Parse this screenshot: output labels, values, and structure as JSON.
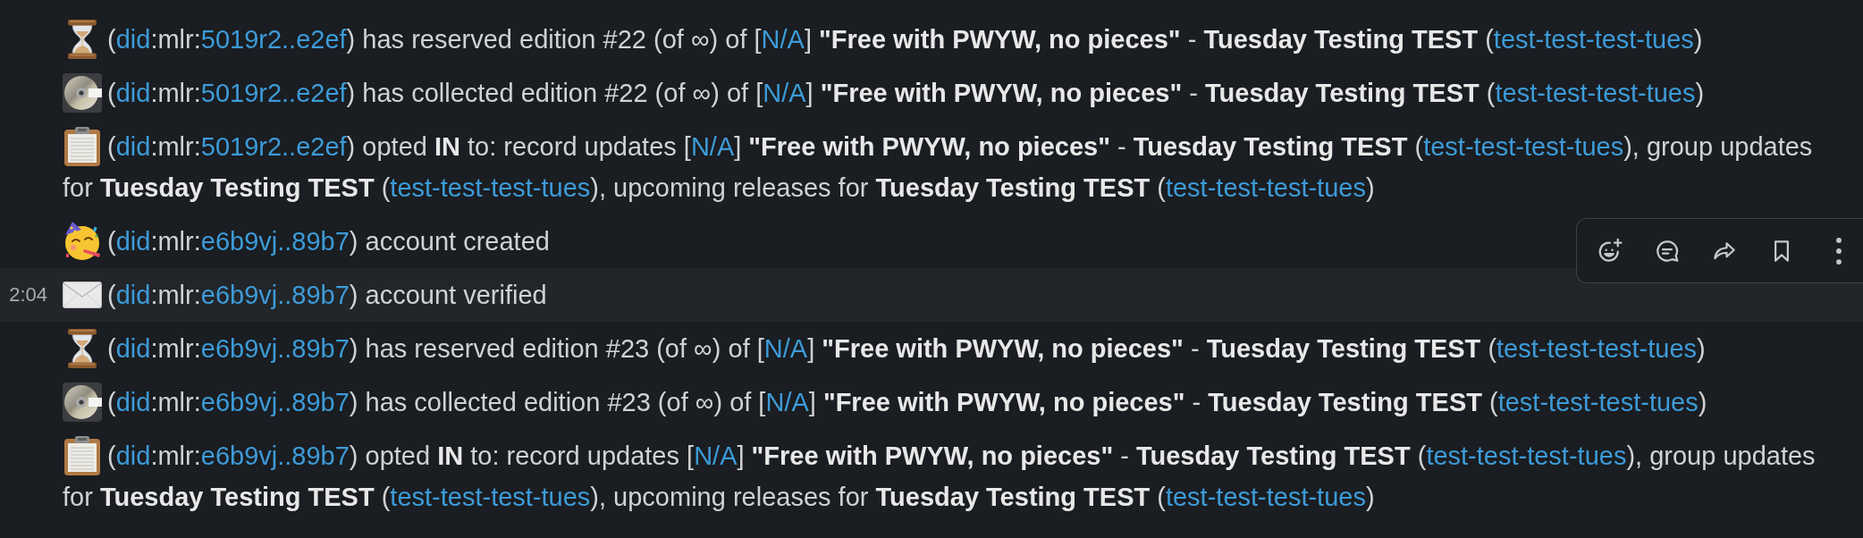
{
  "messages": [
    {
      "kind": "reserve",
      "hovered": false,
      "segments": [
        {
          "kind": "text",
          "text": "("
        },
        {
          "kind": "link",
          "text": "did"
        },
        {
          "kind": "text",
          "text": ":mlr:"
        },
        {
          "kind": "link",
          "text": "5019r2..e2ef"
        },
        {
          "kind": "text",
          "text": ") has reserved edition #22 (of ∞) of ["
        },
        {
          "kind": "link",
          "text": "N/A"
        },
        {
          "kind": "text",
          "text": "] **\"Free with PWYW, no pieces\"** - **Tuesday Testing TEST** ("
        },
        {
          "kind": "link",
          "text": "test-test-test-tues"
        },
        {
          "kind": "text",
          "text": ")"
        }
      ]
    },
    {
      "kind": "collect",
      "hovered": false,
      "segments": [
        {
          "kind": "text",
          "text": "("
        },
        {
          "kind": "link",
          "text": "did"
        },
        {
          "kind": "text",
          "text": ":mlr:"
        },
        {
          "kind": "link",
          "text": "5019r2..e2ef"
        },
        {
          "kind": "text",
          "text": ") has collected edition #22 (of ∞) of ["
        },
        {
          "kind": "link",
          "text": "N/A"
        },
        {
          "kind": "text",
          "text": "] **\"Free with PWYW, no pieces\"** - **Tuesday Testing TEST** ("
        },
        {
          "kind": "link",
          "text": "test-test-test-tues"
        },
        {
          "kind": "text",
          "text": ")"
        }
      ]
    },
    {
      "kind": "subscribe",
      "hovered": false,
      "segments": [
        {
          "kind": "text",
          "text": "("
        },
        {
          "kind": "link",
          "text": "did"
        },
        {
          "kind": "text",
          "text": ":mlr:"
        },
        {
          "kind": "link",
          "text": "5019r2..e2ef"
        },
        {
          "kind": "text",
          "text": ") opted **IN** to: record updates ["
        },
        {
          "kind": "link",
          "text": "N/A"
        },
        {
          "kind": "text",
          "text": "] **\"Free with PWYW, no pieces\"** - **Tuesday Testing TEST** ("
        },
        {
          "kind": "link",
          "text": "test-test-test-tues"
        },
        {
          "kind": "text",
          "text": "), group updates for **Tuesday Testing TEST** ("
        },
        {
          "kind": "link",
          "text": "test-test-test-tues"
        },
        {
          "kind": "text",
          "text": "), upcoming releases for **Tuesday Testing TEST** ("
        },
        {
          "kind": "link",
          "text": "test-test-test-tues"
        },
        {
          "kind": "text",
          "text": ")"
        }
      ]
    },
    {
      "kind": "signup",
      "hovered": false,
      "segments": [
        {
          "kind": "text",
          "text": "("
        },
        {
          "kind": "link",
          "text": "did"
        },
        {
          "kind": "text",
          "text": ":mlr:"
        },
        {
          "kind": "link",
          "text": "e6b9vj..89b7"
        },
        {
          "kind": "text",
          "text": ") account created"
        }
      ]
    },
    {
      "kind": "verify",
      "hovered": true,
      "time": "2:04",
      "segments": [
        {
          "kind": "text",
          "text": "("
        },
        {
          "kind": "link",
          "text": "did"
        },
        {
          "kind": "text",
          "text": ":mlr:"
        },
        {
          "kind": "link",
          "text": "e6b9vj..89b7"
        },
        {
          "kind": "text",
          "text": ") account verified"
        }
      ]
    },
    {
      "kind": "reserve",
      "hovered": false,
      "segments": [
        {
          "kind": "text",
          "text": "("
        },
        {
          "kind": "link",
          "text": "did"
        },
        {
          "kind": "text",
          "text": ":mlr:"
        },
        {
          "kind": "link",
          "text": "e6b9vj..89b7"
        },
        {
          "kind": "text",
          "text": ") has reserved edition #23 (of ∞) of ["
        },
        {
          "kind": "link",
          "text": "N/A"
        },
        {
          "kind": "text",
          "text": "] **\"Free with PWYW, no pieces\"** - **Tuesday Testing TEST** ("
        },
        {
          "kind": "link",
          "text": "test-test-test-tues"
        },
        {
          "kind": "text",
          "text": ")"
        }
      ]
    },
    {
      "kind": "collect",
      "hovered": false,
      "segments": [
        {
          "kind": "text",
          "text": "("
        },
        {
          "kind": "link",
          "text": "did"
        },
        {
          "kind": "text",
          "text": ":mlr:"
        },
        {
          "kind": "link",
          "text": "e6b9vj..89b7"
        },
        {
          "kind": "text",
          "text": ") has collected edition #23 (of ∞) of ["
        },
        {
          "kind": "link",
          "text": "N/A"
        },
        {
          "kind": "text",
          "text": "] **\"Free with PWYW, no pieces\"** - **Tuesday Testing TEST** ("
        },
        {
          "kind": "link",
          "text": "test-test-test-tues"
        },
        {
          "kind": "text",
          "text": ")"
        }
      ]
    },
    {
      "kind": "subscribe",
      "hovered": false,
      "segments": [
        {
          "kind": "text",
          "text": "("
        },
        {
          "kind": "link",
          "text": "did"
        },
        {
          "kind": "text",
          "text": ":mlr:"
        },
        {
          "kind": "link",
          "text": "e6b9vj..89b7"
        },
        {
          "kind": "text",
          "text": ") opted **IN** to: record updates ["
        },
        {
          "kind": "link",
          "text": "N/A"
        },
        {
          "kind": "text",
          "text": "] **\"Free with PWYW, no pieces\"** - **Tuesday Testing TEST** ("
        },
        {
          "kind": "link",
          "text": "test-test-test-tues"
        },
        {
          "kind": "text",
          "text": "), group updates for **Tuesday Testing TEST** ("
        },
        {
          "kind": "link",
          "text": "test-test-test-tues"
        },
        {
          "kind": "text",
          "text": "), upcoming releases for **Tuesday Testing TEST** ("
        },
        {
          "kind": "link",
          "text": "test-test-test-tues"
        },
        {
          "kind": "text",
          "text": ")"
        }
      ]
    }
  ]
}
